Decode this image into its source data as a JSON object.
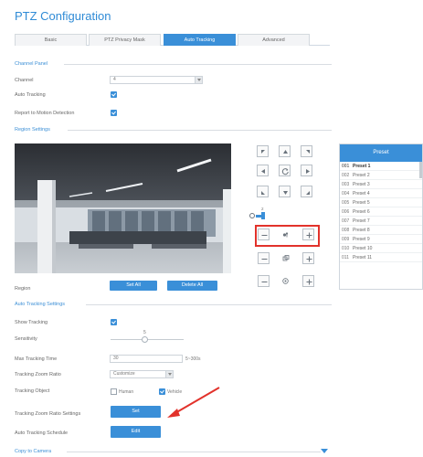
{
  "page": {
    "title": "PTZ Configuration"
  },
  "tabs": [
    {
      "label": "Basic"
    },
    {
      "label": "PTZ Privacy Mask"
    },
    {
      "label": "Auto Tracking",
      "active": true
    },
    {
      "label": "Advanced"
    }
  ],
  "channel_panel": {
    "section": "Channel Panel",
    "channel_label": "Channel",
    "channel_value": "4",
    "auto_tracking_label": "Auto Tracking",
    "report_label": "Report to Motion Detection"
  },
  "region": {
    "section": "Region Settings",
    "label": "Region",
    "set_all": "Set All",
    "delete_all": "Delete All",
    "zoom_small_number": "2"
  },
  "preset": {
    "header": "Preset",
    "rows": [
      {
        "num": "001",
        "name": "Preset 1"
      },
      {
        "num": "002",
        "name": "Preset 2"
      },
      {
        "num": "003",
        "name": "Preset 3"
      },
      {
        "num": "004",
        "name": "Preset 4"
      },
      {
        "num": "005",
        "name": "Preset 5"
      },
      {
        "num": "006",
        "name": "Preset 6"
      },
      {
        "num": "007",
        "name": "Preset 7"
      },
      {
        "num": "008",
        "name": "Preset 8"
      },
      {
        "num": "009",
        "name": "Preset 9"
      },
      {
        "num": "010",
        "name": "Preset 10"
      },
      {
        "num": "011",
        "name": "Preset 11"
      }
    ]
  },
  "auto_tracking": {
    "section": "Auto Tracking Settings",
    "show_tracking_label": "Show Tracking",
    "sensitivity_label": "Sensitivity",
    "sensitivity_value": "5",
    "max_time_label": "Max Tracking Time",
    "max_time_value": "30",
    "max_time_range": "5~300s",
    "zoom_ratio_label": "Tracking Zoom Ratio",
    "zoom_ratio_value": "Customize",
    "object_label": "Tracking Object",
    "human_label": "Human",
    "vehicle_label": "Vehicle",
    "zoom_settings_label": "Tracking Zoom Ratio Settings",
    "zoom_settings_button": "Set",
    "schedule_label": "Auto Tracking Schedule",
    "schedule_button": "Edit"
  },
  "copy": {
    "section": "Copy to Camera"
  },
  "colors": {
    "accent": "#3a8fd8",
    "highlight": "#e2322b"
  }
}
